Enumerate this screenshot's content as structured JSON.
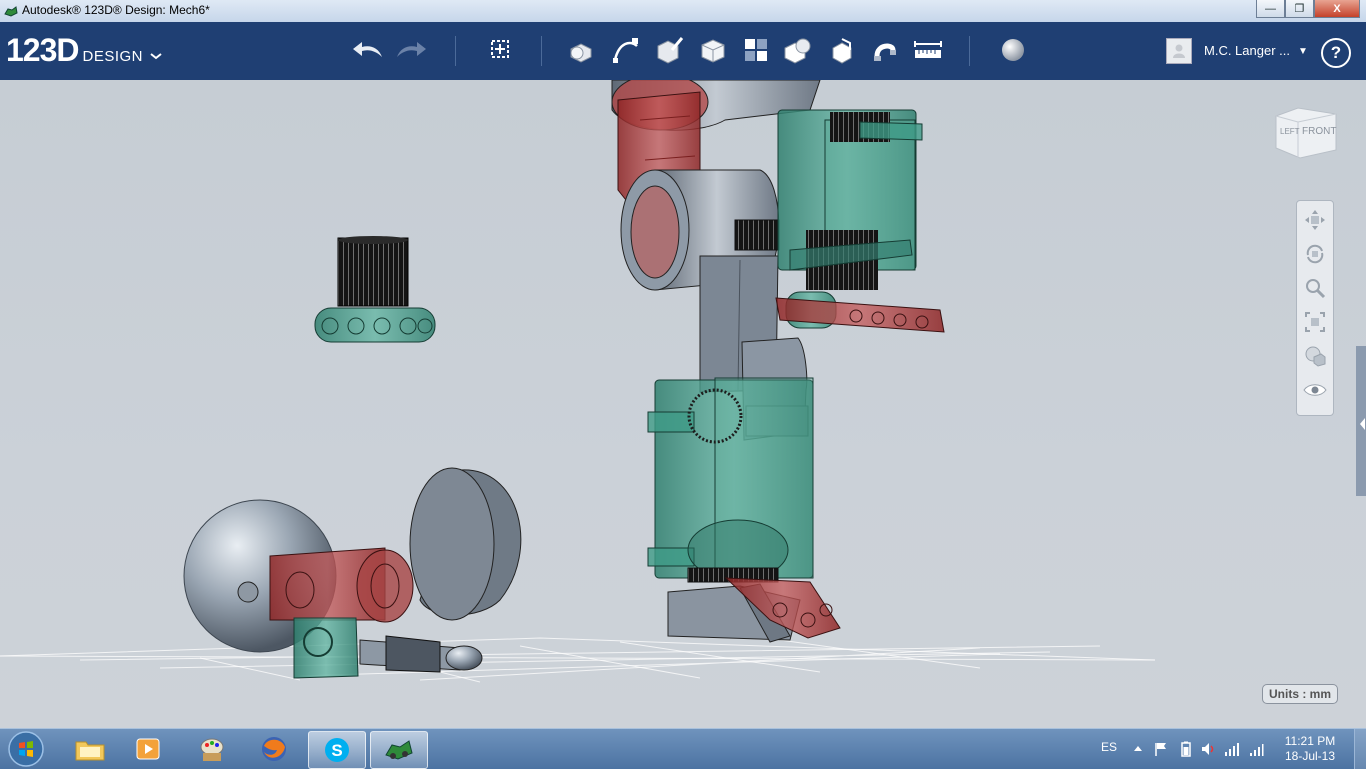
{
  "window": {
    "title": "Autodesk® 123D® Design: Mech6*",
    "buttons": {
      "minimize": "—",
      "maximize": "❐",
      "close": "X"
    }
  },
  "toolbar": {
    "brand_number": "123D",
    "brand_word": "DESIGN",
    "brand_menu_icon": "chevron-down-icon",
    "tools": [
      "undo-icon",
      "redo-icon",
      "transform-icon",
      "primitives-icon",
      "sketch-icon",
      "construct-icon",
      "modify-icon",
      "pattern-icon",
      "grouping-icon",
      "combine-icon",
      "snap-icon",
      "measure-icon",
      "material-icon"
    ],
    "user_name": "M.C. Langer ...",
    "help_label": "?"
  },
  "viewport": {
    "viewcube_left": "LEFT",
    "viewcube_front": "FRONT",
    "nav_tools": [
      "pan-icon",
      "orbit-icon",
      "zoom-icon",
      "fit-icon",
      "view-style-icon",
      "visibility-icon"
    ],
    "units_label": "Units : mm"
  },
  "colors": {
    "teal_part": "#3f9b87",
    "red_part": "#b33b3b",
    "grey_part": "#7f8a96",
    "black_part": "#1a1a1a",
    "toolbar_bg": "#1f3f73"
  },
  "taskbar": {
    "apps": [
      "windows-explorer-icon",
      "media-player-icon",
      "paint-icon",
      "firefox-icon",
      "skype-icon",
      "123d-design-icon"
    ],
    "language": "ES",
    "time": "11:21 PM",
    "date": "18-Jul-13"
  }
}
